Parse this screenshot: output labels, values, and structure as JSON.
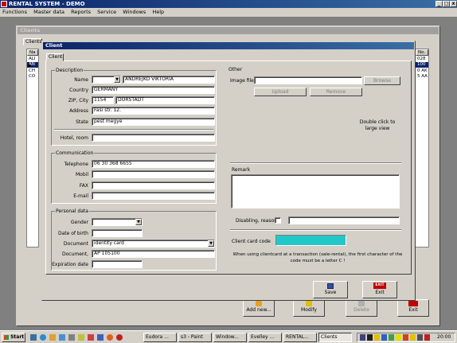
{
  "app": {
    "title": "RENTAL SYSTEM - DEMO",
    "window_buttons": [
      "_",
      "□",
      "x"
    ]
  },
  "menu": [
    "Functions",
    "Master data",
    "Reports",
    "Service",
    "Windows",
    "Help"
  ],
  "clients_window": {
    "title": "Clients",
    "tab": "Clients",
    "col_name": "Na",
    "col_no": "No.",
    "rows_left": [
      "ALI",
      "AN",
      "CH",
      "CO"
    ],
    "rows_right": [
      "028",
      "100",
      "0 AK",
      "5 AA"
    ],
    "buttons": {
      "add": "Add new...",
      "modify": "Modify",
      "delete": "Delete",
      "exit": "Exit"
    }
  },
  "dialog": {
    "title": "Client",
    "tab": "Client",
    "description": {
      "title": "Description",
      "name_label": "Name",
      "name_value": "ANDREJKÓ VIKTÓRIA",
      "country_label": "Country",
      "country_value": "GERMANY",
      "zip_label": "ZIP, City",
      "zip_value": "1154",
      "city_value": "DORSTADT",
      "address_label": "Address",
      "address_value": "Fasi str. 12.",
      "state_label": "State",
      "state_value": "pest megye",
      "hotel_label": "Hotel, room",
      "hotel_value": ""
    },
    "communication": {
      "title": "Communication",
      "telephone_label": "Telephone",
      "telephone_value": "06 30 368 6655",
      "mobil_label": "Mobil",
      "mobil_value": "",
      "fax_label": "FAX",
      "fax_value": "",
      "email_label": "E-mail",
      "email_value": ""
    },
    "personal": {
      "title": "Personal data",
      "gender_label": "Gender",
      "gender_value": "",
      "dob_label": "Date of birth",
      "dob_value": "",
      "document_label": "Document",
      "document_value": "identity card",
      "document_no_label": "Document,",
      "document_no_value": "AP 105100",
      "expiration_label": "Expiration date",
      "expiration_value": ""
    },
    "other": {
      "title": "Other",
      "image_label": "Image file",
      "image_value": "",
      "browse": "Browse",
      "upload": "Upload",
      "remove": "Remove",
      "hint_line1": "Double click to",
      "hint_line2": "large view",
      "remark_label": "Remark",
      "remark_value": "",
      "disabling_label": "Disabling, reason",
      "disabling_value": "",
      "card_label": "Client card code",
      "card_color": "#22c8c8",
      "card_note_line1": "When using clientcard at a transaction (sale-rental), the first character of the",
      "card_note_line2": "code must be a letter C !"
    },
    "save": "Save",
    "exit": "Exit",
    "exit_badge": "EXIT"
  },
  "taskbar": {
    "start": "Start",
    "tasks": [
      "Eudora ...",
      "s3 - Paint",
      "Window...",
      "Evelley ...",
      "RENTAL...",
      "Clients"
    ],
    "clock": "20:00"
  }
}
